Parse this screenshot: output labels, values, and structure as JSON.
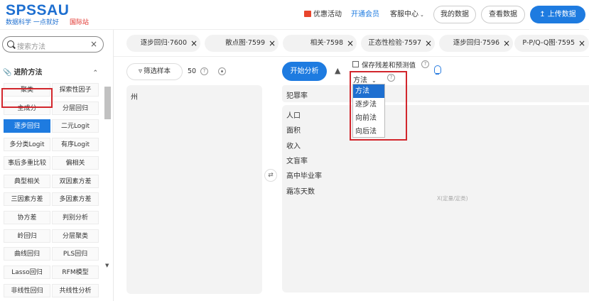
{
  "header": {
    "logo": "SPSSAU",
    "logo_sub": "数据科学 一点就好",
    "logo_intl": "国际站",
    "nav": {
      "promo": "优惠活动",
      "member": "开通会员",
      "service": "客服中心",
      "my_data": "我的数据",
      "view_data": "查看数据",
      "upload": "上传数据"
    },
    "colors": {
      "brand": "#1e7be0",
      "accent_red": "#e0302a"
    }
  },
  "sidebar": {
    "search_placeholder": "搜索方法",
    "section_title": "进阶方法",
    "items": [
      {
        "label": "聚类"
      },
      {
        "label": "探索性因子"
      },
      {
        "label": "主成分"
      },
      {
        "label": "分层回归"
      },
      {
        "label": "逐步回归",
        "active": true
      },
      {
        "label": "二元Logit"
      },
      {
        "label": "多分类Logit"
      },
      {
        "label": "有序Logit"
      },
      {
        "label": "事后多重比较"
      },
      {
        "label": "偏相关"
      },
      {
        "label": "典型相关"
      },
      {
        "label": "双因素方差"
      },
      {
        "label": "三因素方差"
      },
      {
        "label": "多因素方差"
      },
      {
        "label": "协方差"
      },
      {
        "label": "判别分析"
      },
      {
        "label": "岭回归"
      },
      {
        "label": "分层聚类"
      },
      {
        "label": "曲线回归"
      },
      {
        "label": "PLS回归"
      },
      {
        "label": "Lasso回归"
      },
      {
        "label": "RFM模型"
      },
      {
        "label": "非线性回归"
      },
      {
        "label": "共线性分析"
      }
    ]
  },
  "tabs": [
    {
      "label": "逐步回归·7600"
    },
    {
      "label": "散点图·7599"
    },
    {
      "label": "相关·7598"
    },
    {
      "label": "正态性检验·7597"
    },
    {
      "label": "逐步回归·7596"
    },
    {
      "label": "P-P/Q-Q图·7595"
    }
  ],
  "left_panel": {
    "filter_label": "筛选样本",
    "sample_count": "50",
    "variables": [
      "州"
    ]
  },
  "analysis": {
    "start_label": "开始分析",
    "save_residual_label": "保存残差和预测值",
    "method_label": "方法",
    "method_options": [
      {
        "label": "方法",
        "selected": true
      },
      {
        "label": "逐步法"
      },
      {
        "label": "向前法"
      },
      {
        "label": "向后法"
      }
    ],
    "y_variable": "犯罪率",
    "x_variables": [
      "人口",
      "面积",
      "收入",
      "文盲率",
      "高中毕业率",
      "霜冻天数"
    ],
    "x_hint": "X(定量/定类)"
  }
}
